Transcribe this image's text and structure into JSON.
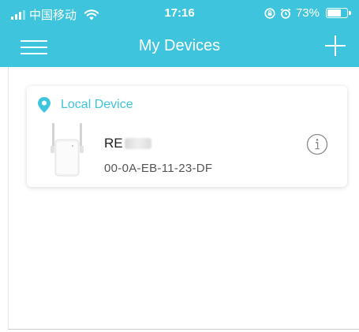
{
  "status_bar": {
    "carrier": "中国移动",
    "time": "17:16",
    "battery_text": "73%",
    "battery_level": 0.73,
    "icons": [
      "signal-icon",
      "wifi-icon",
      "orientation-lock-icon",
      "alarm-icon",
      "battery-icon"
    ]
  },
  "header": {
    "title": "My Devices",
    "menu_icon": "hamburger-menu-icon",
    "add_icon": "plus-icon"
  },
  "device_group": {
    "label": "Local Device",
    "icon": "location-pin-icon",
    "devices": [
      {
        "name": "RE",
        "name_redacted": true,
        "mac": "00-0A-EB-11-23-DF",
        "image": "range-extender-icon",
        "info_icon": "info-icon"
      }
    ]
  },
  "colors": {
    "accent": "#3fc4dd",
    "header_text": "#ffffff",
    "device_name": "#1f1f1f",
    "mac_text": "#555555"
  }
}
